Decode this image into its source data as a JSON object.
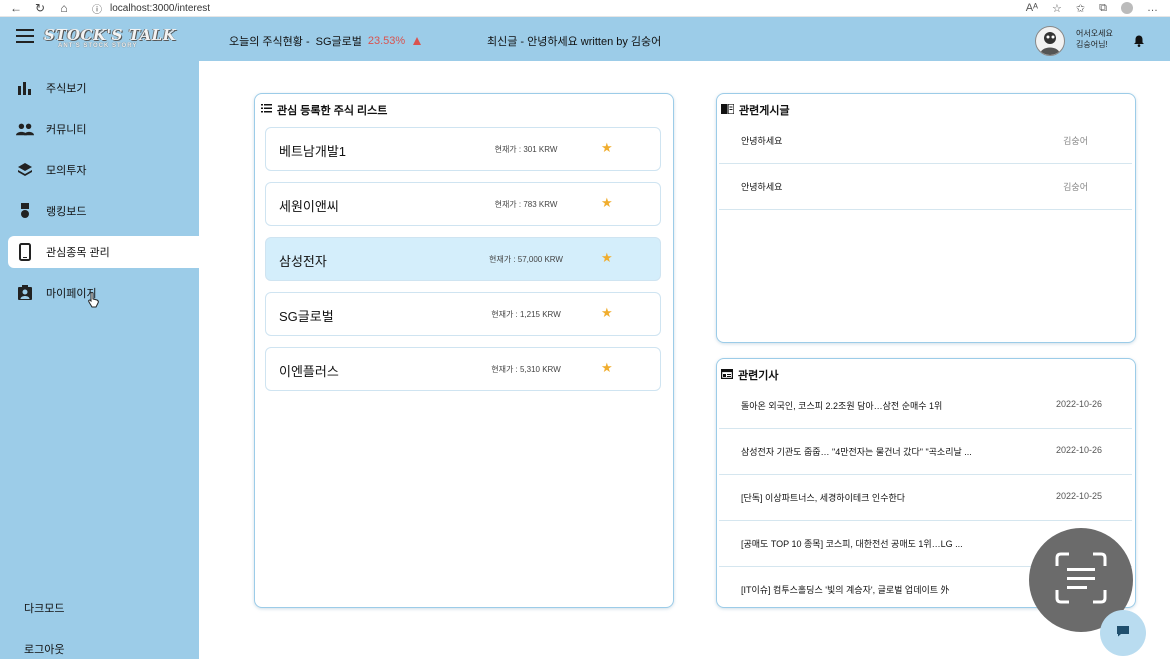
{
  "browser": {
    "url": "localhost:3000/interest"
  },
  "sidebar": {
    "logo": "STOCK'S TALK",
    "logo_sub": "ANT'S STOCK STORY",
    "items": [
      {
        "label": "주식보기",
        "icon": "bar-chart-icon"
      },
      {
        "label": "커뮤니티",
        "icon": "people-icon"
      },
      {
        "label": "모의투자",
        "icon": "layers-icon"
      },
      {
        "label": "랭킹보드",
        "icon": "medal-icon"
      },
      {
        "label": "관심종목 관리",
        "icon": "smartphone-icon",
        "active": true
      },
      {
        "label": "마이페이지",
        "icon": "contact-icon"
      }
    ],
    "dark_mode": "다크모드",
    "logout": "로그아웃"
  },
  "header": {
    "ticker_label": "오늘의 주식현황 -",
    "ticker_stock": "SG글로벌",
    "ticker_pct": "23.53%",
    "latest": "최신글 - 안녕하세요 written by 김숭어",
    "greeting_line1": "어서오세요",
    "greeting_line2": "김숭어님!"
  },
  "watchlist": {
    "title": "관심 등록한 주식 리스트",
    "items": [
      {
        "name": "베트남개발1",
        "price": "현재가 : 301 KRW"
      },
      {
        "name": "세원이앤씨",
        "price": "현재가 : 783 KRW"
      },
      {
        "name": "삼성전자",
        "price": "현재가 : 57,000 KRW"
      },
      {
        "name": "SG글로벌",
        "price": "현재가 : 1,215 KRW"
      },
      {
        "name": "이엔플러스",
        "price": "현재가 : 5,310 KRW"
      }
    ]
  },
  "posts": {
    "title": "관련게시글",
    "items": [
      {
        "title": "안녕하세요",
        "author": "김숭어"
      },
      {
        "title": "안녕하세요",
        "author": "김숭어"
      }
    ]
  },
  "news": {
    "title": "관련기사",
    "items": [
      {
        "title": "돌아온 외국인, 코스피 2.2조원 담아…삼전 순매수 1위",
        "date": "2022-10-26"
      },
      {
        "title": "삼성전자 기관도 줍줍… \"4만전자는 물건너 갔다\" \"곡소리날 ...",
        "date": "2022-10-26"
      },
      {
        "title": "[단독] 이상파트너스, 세경하이테크 인수한다",
        "date": "2022-10-25"
      },
      {
        "title": "[공매도 TOP 10 종목] 코스피, 대한전선 공매도 1위…LG ...",
        "date": ""
      },
      {
        "title": "[IT이슈] 컴투스홀딩스 '빛의 계승자', 글로벌 업데이트 外",
        "date": ""
      }
    ]
  },
  "colors": {
    "sidebar": "#9ccce8",
    "highlight": "#d4eefb",
    "star": "#f0ad2e",
    "up": "#d9534f"
  }
}
